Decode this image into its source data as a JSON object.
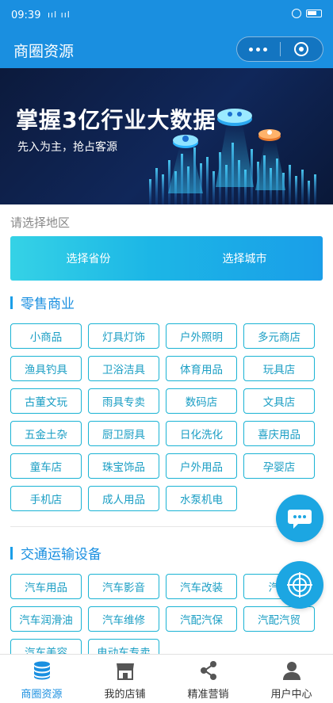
{
  "status_bar": {
    "time": "09:39",
    "signal": "ııl ııl"
  },
  "nav": {
    "title": "商圈资源"
  },
  "banner": {
    "title": "掌握3亿行业大数据",
    "subtitle": "先入为主，抢占客源"
  },
  "region": {
    "label": "请选择地区",
    "province_btn": "选择省份",
    "city_btn": "选择城市"
  },
  "sections": [
    {
      "title": "零售商业",
      "tags": [
        "小商品",
        "灯具灯饰",
        "户外照明",
        "多元商店",
        "渔具钓具",
        "卫浴洁具",
        "体育用品",
        "玩具店",
        "古董文玩",
        "雨具专卖",
        "数码店",
        "文具店",
        "五金土杂",
        "厨卫厨具",
        "日化洗化",
        "喜庆用品",
        "童车店",
        "珠宝饰品",
        "户外用品",
        "孕婴店",
        "手机店",
        "成人用品",
        "水泵机电"
      ]
    },
    {
      "title": "交通运输设备",
      "tags": [
        "汽车用品",
        "汽车影音",
        "汽车改装",
        "汽车",
        "汽车润滑油",
        "汽车维修",
        "汽配汽保",
        "汽配汽贸",
        "汽车美容",
        "电动车专卖"
      ]
    }
  ],
  "tab_bar": {
    "items": [
      {
        "label": "商圈资源",
        "icon": "database-icon",
        "active": true
      },
      {
        "label": "我的店铺",
        "icon": "store-icon",
        "active": false
      },
      {
        "label": "精准营销",
        "icon": "share-icon",
        "active": false
      },
      {
        "label": "用户中心",
        "icon": "user-icon",
        "active": false
      }
    ]
  },
  "colors": {
    "primary": "#1a8fe0",
    "tag_border": "#1ab3d4",
    "tag_text": "#1a9ec4",
    "banner_bg": "#0c1a3c"
  }
}
